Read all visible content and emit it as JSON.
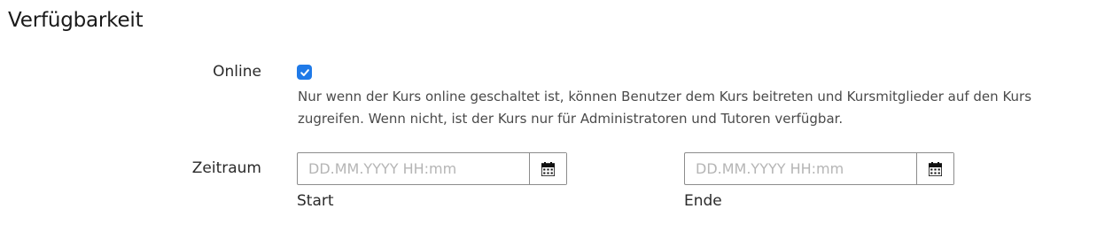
{
  "section": {
    "title": "Verfügbarkeit"
  },
  "online": {
    "label": "Online",
    "checked": true,
    "help_lines": [
      "Nur wenn der Kurs online geschaltet ist, können Benutzer dem Kurs beitreten und Kursmitglieder auf den Kurs",
      "zugreifen. Wenn nicht, ist der Kurs nur für Administratoren und Tutoren verfügbar."
    ]
  },
  "period": {
    "label": "Zeitraum",
    "start": {
      "value": "",
      "placeholder": "DD.MM.YYYY HH:mm",
      "caption": "Start",
      "icon": "calendar-icon"
    },
    "end": {
      "value": "",
      "placeholder": "DD.MM.YYYY HH:mm",
      "caption": "Ende",
      "icon": "calendar-icon"
    }
  },
  "colors": {
    "accent": "#1f7ae8",
    "border": "#8c8c8c",
    "placeholder": "#b5b5b5"
  }
}
